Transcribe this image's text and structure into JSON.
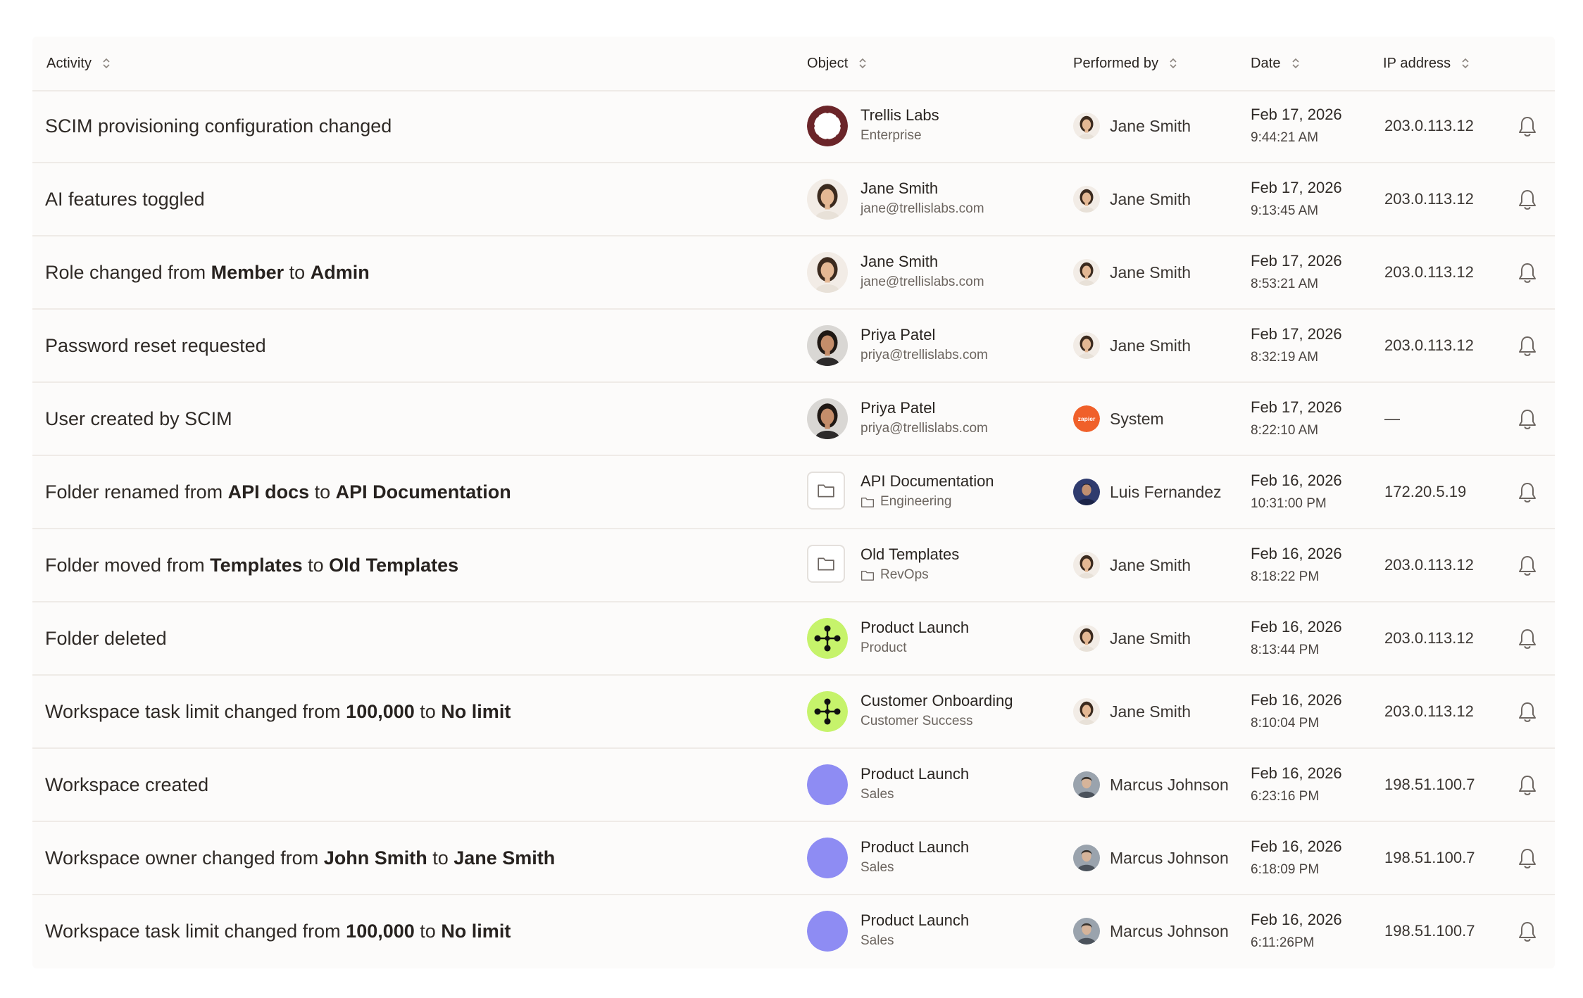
{
  "table": {
    "columns": {
      "activity": "Activity",
      "object": "Object",
      "performed_by": "Performed by",
      "date": "Date",
      "ip_address": "IP address"
    },
    "rows": [
      {
        "activity": [
          {
            "t": "SCIM provisioning configuration changed",
            "b": false
          }
        ],
        "object": {
          "title": "Trellis Labs",
          "subtitle": "Enterprise",
          "icon": "org-logo-icon",
          "sub_icon": ""
        },
        "performer": {
          "name": "Jane Smith",
          "avatar": "jane-avatar"
        },
        "date": "Feb 17, 2026",
        "time": "9:44:21 AM",
        "ip": "203.0.113.12"
      },
      {
        "activity": [
          {
            "t": "AI features toggled",
            "b": false
          }
        ],
        "object": {
          "title": "Jane Smith",
          "subtitle": "jane@trellislabs.com",
          "icon": "jane-avatar",
          "sub_icon": ""
        },
        "performer": {
          "name": "Jane Smith",
          "avatar": "jane-avatar"
        },
        "date": "Feb 17, 2026",
        "time": "9:13:45 AM",
        "ip": "203.0.113.12"
      },
      {
        "activity": [
          {
            "t": "Role changed from ",
            "b": false
          },
          {
            "t": "Member",
            "b": true
          },
          {
            "t": " to ",
            "b": false
          },
          {
            "t": "Admin",
            "b": true
          }
        ],
        "object": {
          "title": "Jane Smith",
          "subtitle": "jane@trellislabs.com",
          "icon": "jane-avatar",
          "sub_icon": ""
        },
        "performer": {
          "name": "Jane Smith",
          "avatar": "jane-avatar"
        },
        "date": "Feb 17, 2026",
        "time": "8:53:21 AM",
        "ip": "203.0.113.12"
      },
      {
        "activity": [
          {
            "t": "Password reset requested",
            "b": false
          }
        ],
        "object": {
          "title": "Priya Patel",
          "subtitle": "priya@trellislabs.com",
          "icon": "priya-avatar",
          "sub_icon": ""
        },
        "performer": {
          "name": "Jane Smith",
          "avatar": "jane-avatar"
        },
        "date": "Feb 17, 2026",
        "time": "8:32:19 AM",
        "ip": "203.0.113.12"
      },
      {
        "activity": [
          {
            "t": "User created by SCIM",
            "b": false
          }
        ],
        "object": {
          "title": "Priya Patel",
          "subtitle": "priya@trellislabs.com",
          "icon": "priya-avatar",
          "sub_icon": ""
        },
        "performer": {
          "name": "System",
          "avatar": "system-logo",
          "logo_text": "zapier"
        },
        "date": "Feb 17, 2026",
        "time": "8:22:10 AM",
        "ip": "—"
      },
      {
        "activity": [
          {
            "t": "Folder renamed from ",
            "b": false
          },
          {
            "t": "API docs",
            "b": true
          },
          {
            "t": " to ",
            "b": false
          },
          {
            "t": "API Documentation",
            "b": true
          }
        ],
        "object": {
          "title": "API Documentation",
          "subtitle": "Engineering",
          "icon": "folder-icon",
          "sub_icon": "folder-icon"
        },
        "performer": {
          "name": "Luis Fernandez",
          "avatar": "luis-avatar"
        },
        "date": "Feb 16, 2026",
        "time": "10:31:00 PM",
        "ip": "172.20.5.19"
      },
      {
        "activity": [
          {
            "t": "Folder moved from ",
            "b": false
          },
          {
            "t": "Templates",
            "b": true
          },
          {
            "t": " to ",
            "b": false
          },
          {
            "t": "Old Templates",
            "b": true
          }
        ],
        "object": {
          "title": "Old Templates",
          "subtitle": "RevOps",
          "icon": "folder-icon",
          "sub_icon": "folder-icon"
        },
        "performer": {
          "name": "Jane Smith",
          "avatar": "jane-avatar"
        },
        "date": "Feb 16, 2026",
        "time": "8:18:22 PM",
        "ip": "203.0.113.12"
      },
      {
        "activity": [
          {
            "t": "Folder deleted",
            "b": false
          }
        ],
        "object": {
          "title": "Product Launch",
          "subtitle": "Product",
          "icon": "workflow-icon",
          "sub_icon": ""
        },
        "performer": {
          "name": "Jane Smith",
          "avatar": "jane-avatar"
        },
        "date": "Feb 16, 2026",
        "time": "8:13:44 PM",
        "ip": "203.0.113.12"
      },
      {
        "activity": [
          {
            "t": "Workspace task limit changed from ",
            "b": false
          },
          {
            "t": "100,000",
            "b": true
          },
          {
            "t": " to ",
            "b": false
          },
          {
            "t": "No limit",
            "b": true
          }
        ],
        "object": {
          "title": "Customer Onboarding",
          "subtitle": "Customer Success",
          "icon": "workflow-icon",
          "sub_icon": ""
        },
        "performer": {
          "name": "Jane Smith",
          "avatar": "jane-avatar"
        },
        "date": "Feb 16, 2026",
        "time": "8:10:04 PM",
        "ip": "203.0.113.12"
      },
      {
        "activity": [
          {
            "t": "Workspace created",
            "b": false
          }
        ],
        "object": {
          "title": "Product Launch",
          "subtitle": "Sales",
          "icon": "workspace-dot",
          "sub_icon": ""
        },
        "performer": {
          "name": "Marcus Johnson",
          "avatar": "marcus-avatar"
        },
        "date": "Feb 16, 2026",
        "time": "6:23:16 PM",
        "ip": "198.51.100.7"
      },
      {
        "activity": [
          {
            "t": "Workspace owner changed from ",
            "b": false
          },
          {
            "t": "John Smith",
            "b": true
          },
          {
            "t": " to ",
            "b": false
          },
          {
            "t": "Jane Smith",
            "b": true
          }
        ],
        "object": {
          "title": "Product Launch",
          "subtitle": "Sales",
          "icon": "workspace-dot",
          "sub_icon": ""
        },
        "performer": {
          "name": "Marcus Johnson",
          "avatar": "marcus-avatar"
        },
        "date": "Feb 16, 2026",
        "time": "6:18:09 PM",
        "ip": "198.51.100.7"
      },
      {
        "activity": [
          {
            "t": "Workspace task limit changed from ",
            "b": false
          },
          {
            "t": "100,000",
            "b": true
          },
          {
            "t": " to ",
            "b": false
          },
          {
            "t": "No limit",
            "b": true
          }
        ],
        "object": {
          "title": "Product Launch",
          "subtitle": "Sales",
          "icon": "workspace-dot",
          "sub_icon": ""
        },
        "performer": {
          "name": "Marcus Johnson",
          "avatar": "marcus-avatar"
        },
        "date": "Feb 16, 2026",
        "time": "6:11:26PM",
        "ip": "198.51.100.7"
      }
    ]
  },
  "colors": {
    "workflow_bg": "#c6f36b",
    "workspace_dot": "#8e8cf3",
    "system_logo": "#f0602a",
    "org_ring": "#6b2529"
  }
}
